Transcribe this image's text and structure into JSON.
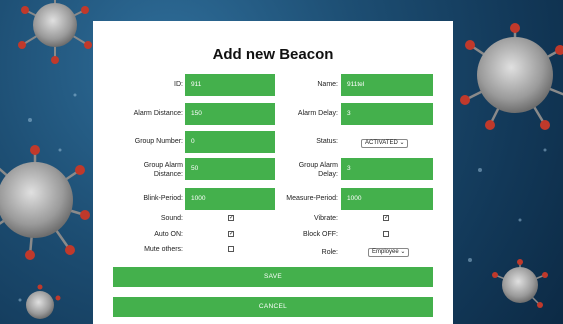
{
  "title": "Add new Beacon",
  "fields": {
    "id": {
      "label": "ID:",
      "value": "911"
    },
    "name": {
      "label": "Name:",
      "value": "911tel"
    },
    "alarm_distance": {
      "label": "Alarm Distance:",
      "value": "150"
    },
    "alarm_delay": {
      "label": "Alarm Delay:",
      "value": "3"
    },
    "group_number": {
      "label": "Group Number:",
      "value": "0"
    },
    "status": {
      "label": "Status:",
      "value": "ACTIVATED"
    },
    "group_alarm_distance": {
      "label_line1": "Group Alarm",
      "label_line2": "Distance:",
      "value": "50"
    },
    "group_alarm_delay": {
      "label_line1": "Group Alarm",
      "label_line2": "Delay:",
      "value": "3"
    },
    "blink_period": {
      "label": "Blink-Period:",
      "value": "1000"
    },
    "measure_period": {
      "label": "Measure-Period:",
      "value": "1000"
    }
  },
  "checkboxes": {
    "sound": {
      "label": "Sound:",
      "checked": true
    },
    "vibrate": {
      "label": "Vibrate:",
      "checked": true
    },
    "auto_on": {
      "label": "Auto ON:",
      "checked": true
    },
    "block_off": {
      "label": "Block OFF:",
      "checked": false
    },
    "mute_others": {
      "label": "Mute others:",
      "checked": false
    }
  },
  "role": {
    "label": "Role:",
    "value": "Employee"
  },
  "buttons": {
    "save": "SAVE",
    "cancel": "CANCEL"
  },
  "colors": {
    "accent": "#44b04c",
    "panel": "#ffffff",
    "background": "#1d4e73",
    "virus": "#b8b8b8",
    "virus_spikes": "#c0392b"
  }
}
